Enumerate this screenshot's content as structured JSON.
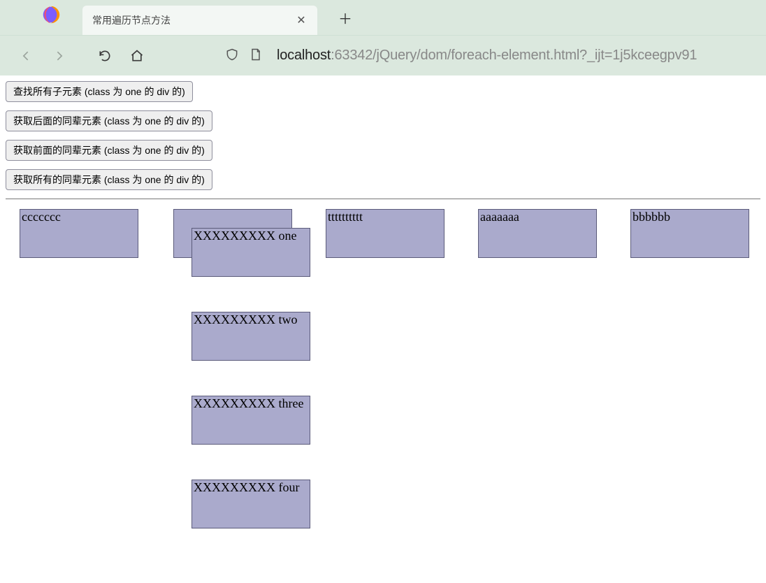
{
  "browser": {
    "tab_title": "常用遍历节点方法",
    "url_prefix": "localhost",
    "url_rest": ":63342/jQuery/dom/foreach-element.html?_ijt=1j5kceegpv91"
  },
  "buttons": {
    "find_children": "查找所有子元素 (class 为 one 的 div 的)",
    "next_siblings": "获取后面的同辈元素 (class 为 one 的 div 的)",
    "prev_siblings": "获取前面的同辈元素 (class 为 one 的 div 的)",
    "all_siblings": "获取所有的同辈元素 (class 为 one 的 div 的)"
  },
  "boxes": {
    "c": "ccccccc",
    "one": "XXXXXXXXX one",
    "two": "XXXXXXXXX two",
    "three": "XXXXXXXXX three",
    "four": "XXXXXXXXX four",
    "t": "tttttttttt",
    "a": "aaaaaaa",
    "b": "bbbbbb"
  }
}
